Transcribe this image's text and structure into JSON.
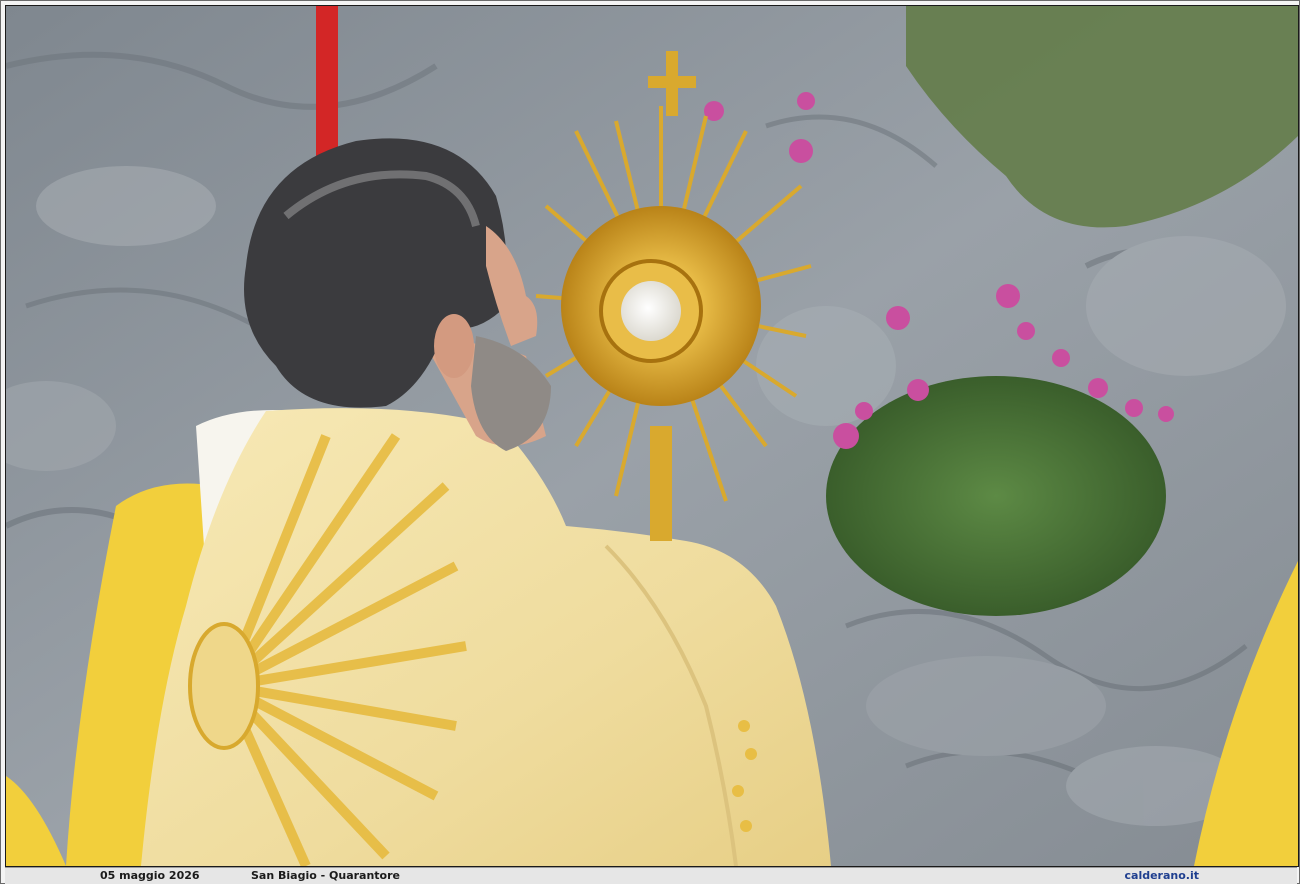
{
  "caption": {
    "date": "05 maggio 2026",
    "title": "San Biagio - Quarantore",
    "site": "calderano.it"
  },
  "scene": {
    "main_subject": "priest-in-cope-holding-monstrance",
    "colors": {
      "rock": "#8f979e",
      "vestment": "#f3e4a8",
      "gold": "#d9a92e",
      "foliage": "#4f7a3a",
      "flowers": "#c94f9f",
      "hair": "#3b3b3e",
      "skin": "#d8a48a",
      "staff": "#d32626"
    }
  }
}
